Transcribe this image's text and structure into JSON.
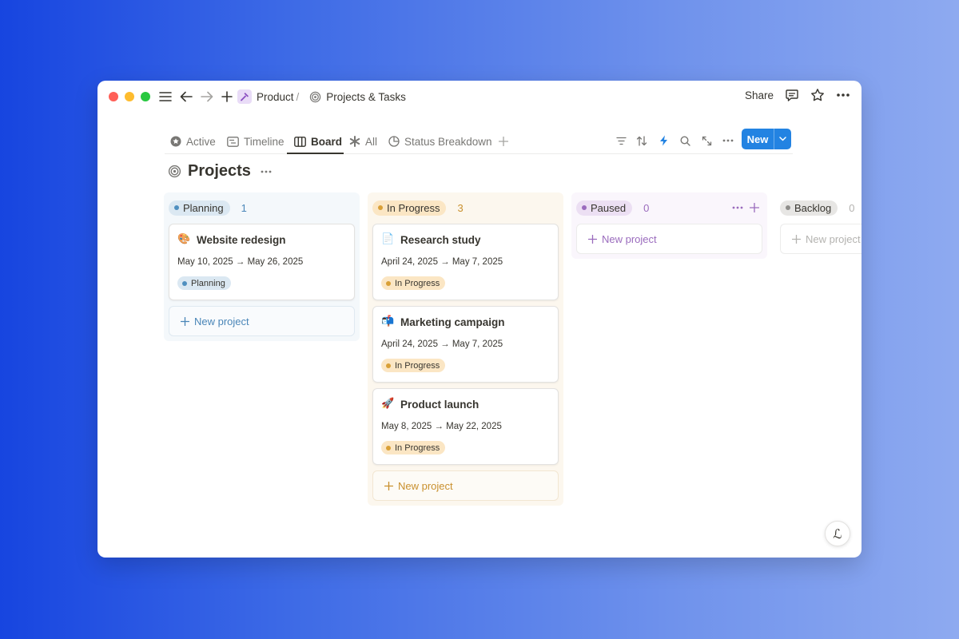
{
  "window": {
    "breadcrumb": {
      "workspace": "Product",
      "separator": "/",
      "page": "Projects & Tasks"
    },
    "share_label": "Share"
  },
  "tabs": [
    {
      "label": "Active",
      "icon": "star-circle-icon"
    },
    {
      "label": "Timeline",
      "icon": "timeline-icon"
    },
    {
      "label": "Board",
      "icon": "board-icon",
      "active": true
    },
    {
      "label": "All",
      "icon": "asterisk-icon"
    },
    {
      "label": "Status Breakdown",
      "icon": "pie-chart-icon"
    }
  ],
  "toolbar": {
    "new_label": "New"
  },
  "page": {
    "title": "Projects"
  },
  "columns": [
    {
      "name": "Planning",
      "count": "1",
      "new_label": "New project",
      "bg": "#f4f8fb",
      "pill_bg": "#dbe8f2",
      "dot": "#4f8fbf",
      "accent": "#4a86b8",
      "cards": [
        {
          "emoji": "🎨",
          "title": "Website redesign",
          "dates": "May 10, 2025 → May 26, 2025",
          "status": "Planning"
        }
      ]
    },
    {
      "name": "In Progress",
      "count": "3",
      "new_label": "New project",
      "bg": "#fcf7ee",
      "pill_bg": "#fbe6c4",
      "dot": "#d9a037",
      "accent": "#c9902e",
      "cards": [
        {
          "emoji": "📄",
          "title": "Research study",
          "dates": "April 24, 2025 → May 7, 2025",
          "status": "In Progress"
        },
        {
          "emoji": "📬",
          "title": "Marketing campaign",
          "dates": "April 24, 2025 → May 7, 2025",
          "status": "In Progress"
        },
        {
          "emoji": "🚀",
          "title": "Product launch",
          "dates": "May 8, 2025 → May 22, 2025",
          "status": "In Progress"
        }
      ]
    },
    {
      "name": "Paused",
      "count": "0",
      "new_label": "New project",
      "bg": "#faf6fc",
      "pill_bg": "#ecdff3",
      "dot": "#9a6bbd",
      "accent": "#9a6bbd",
      "cards": []
    },
    {
      "name": "Backlog",
      "count": "0",
      "new_label": "New project",
      "bg": "#ffffff",
      "pill_bg": "#e7e6e4",
      "dot": "#8e8d8a",
      "accent": "#b4b3b0",
      "cards": []
    }
  ],
  "assistant": {
    "glyph": "ℒ"
  }
}
